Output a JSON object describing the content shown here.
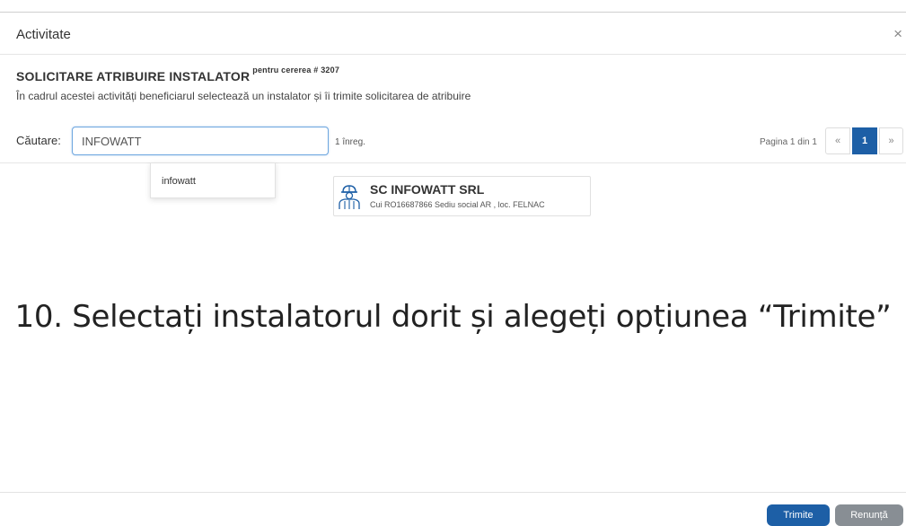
{
  "dialog": {
    "title": "Activitate",
    "close_glyph": "×"
  },
  "activity": {
    "heading": "SOLICITARE ATRIBUIRE INSTALATOR",
    "heading_suffix": "pentru cererea # 3207",
    "description": "În cadrul acestei activități beneficiarul selectează un instalator și îi trimite solicitarea de atribuire"
  },
  "search": {
    "label": "Căutare:",
    "value": "INFOWATT",
    "record_count": "1 înreg.",
    "suggestion": "infowatt"
  },
  "pagination": {
    "info": "Pagina 1 din 1",
    "prev": "«",
    "current": "1",
    "next": "»"
  },
  "result": {
    "icon": "worker-icon",
    "name": "SC INFOWATT SRL",
    "details": "Cui RO16687866 Sediu social AR , loc. FELNAC"
  },
  "caption": "10. Selectați instalatorul dorit și alegeți opțiunea “Trimite”",
  "footer": {
    "send_label": "Trimite",
    "cancel_label": "Renunță"
  },
  "colors": {
    "primary": "#1d5fa6",
    "secondary": "#888e94",
    "input_focus_border": "#6ea7e0"
  }
}
